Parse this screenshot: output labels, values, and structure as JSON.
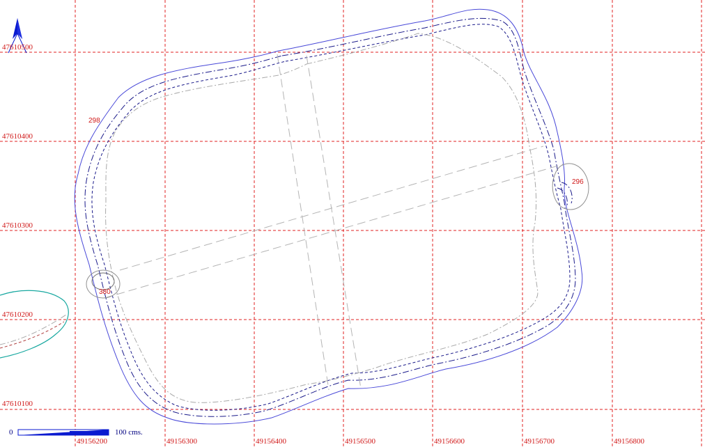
{
  "map": {
    "x_coordinate_labels": [
      "49156200",
      "49156300",
      "49156400",
      "49156500",
      "49156600",
      "49156700",
      "49156800"
    ],
    "y_coordinate_labels": [
      "47610500",
      "47610400",
      "47610300",
      "47610200",
      "47610100"
    ],
    "elevation_labels": [
      "298",
      "296",
      "380"
    ],
    "scale_bar": {
      "start_label": "0",
      "end_label": "100 cms."
    },
    "colors": {
      "grid": "#e02020",
      "labels": "#d01818",
      "outer_contour": "#4848d8",
      "dashed_contours": "#1a1a8a",
      "inner_features": "#b4b4b4",
      "water_edge": "#18a8a0",
      "scale_bar": "#0a1ad0"
    },
    "icons": {
      "north_arrow": "north-arrow-icon"
    }
  }
}
